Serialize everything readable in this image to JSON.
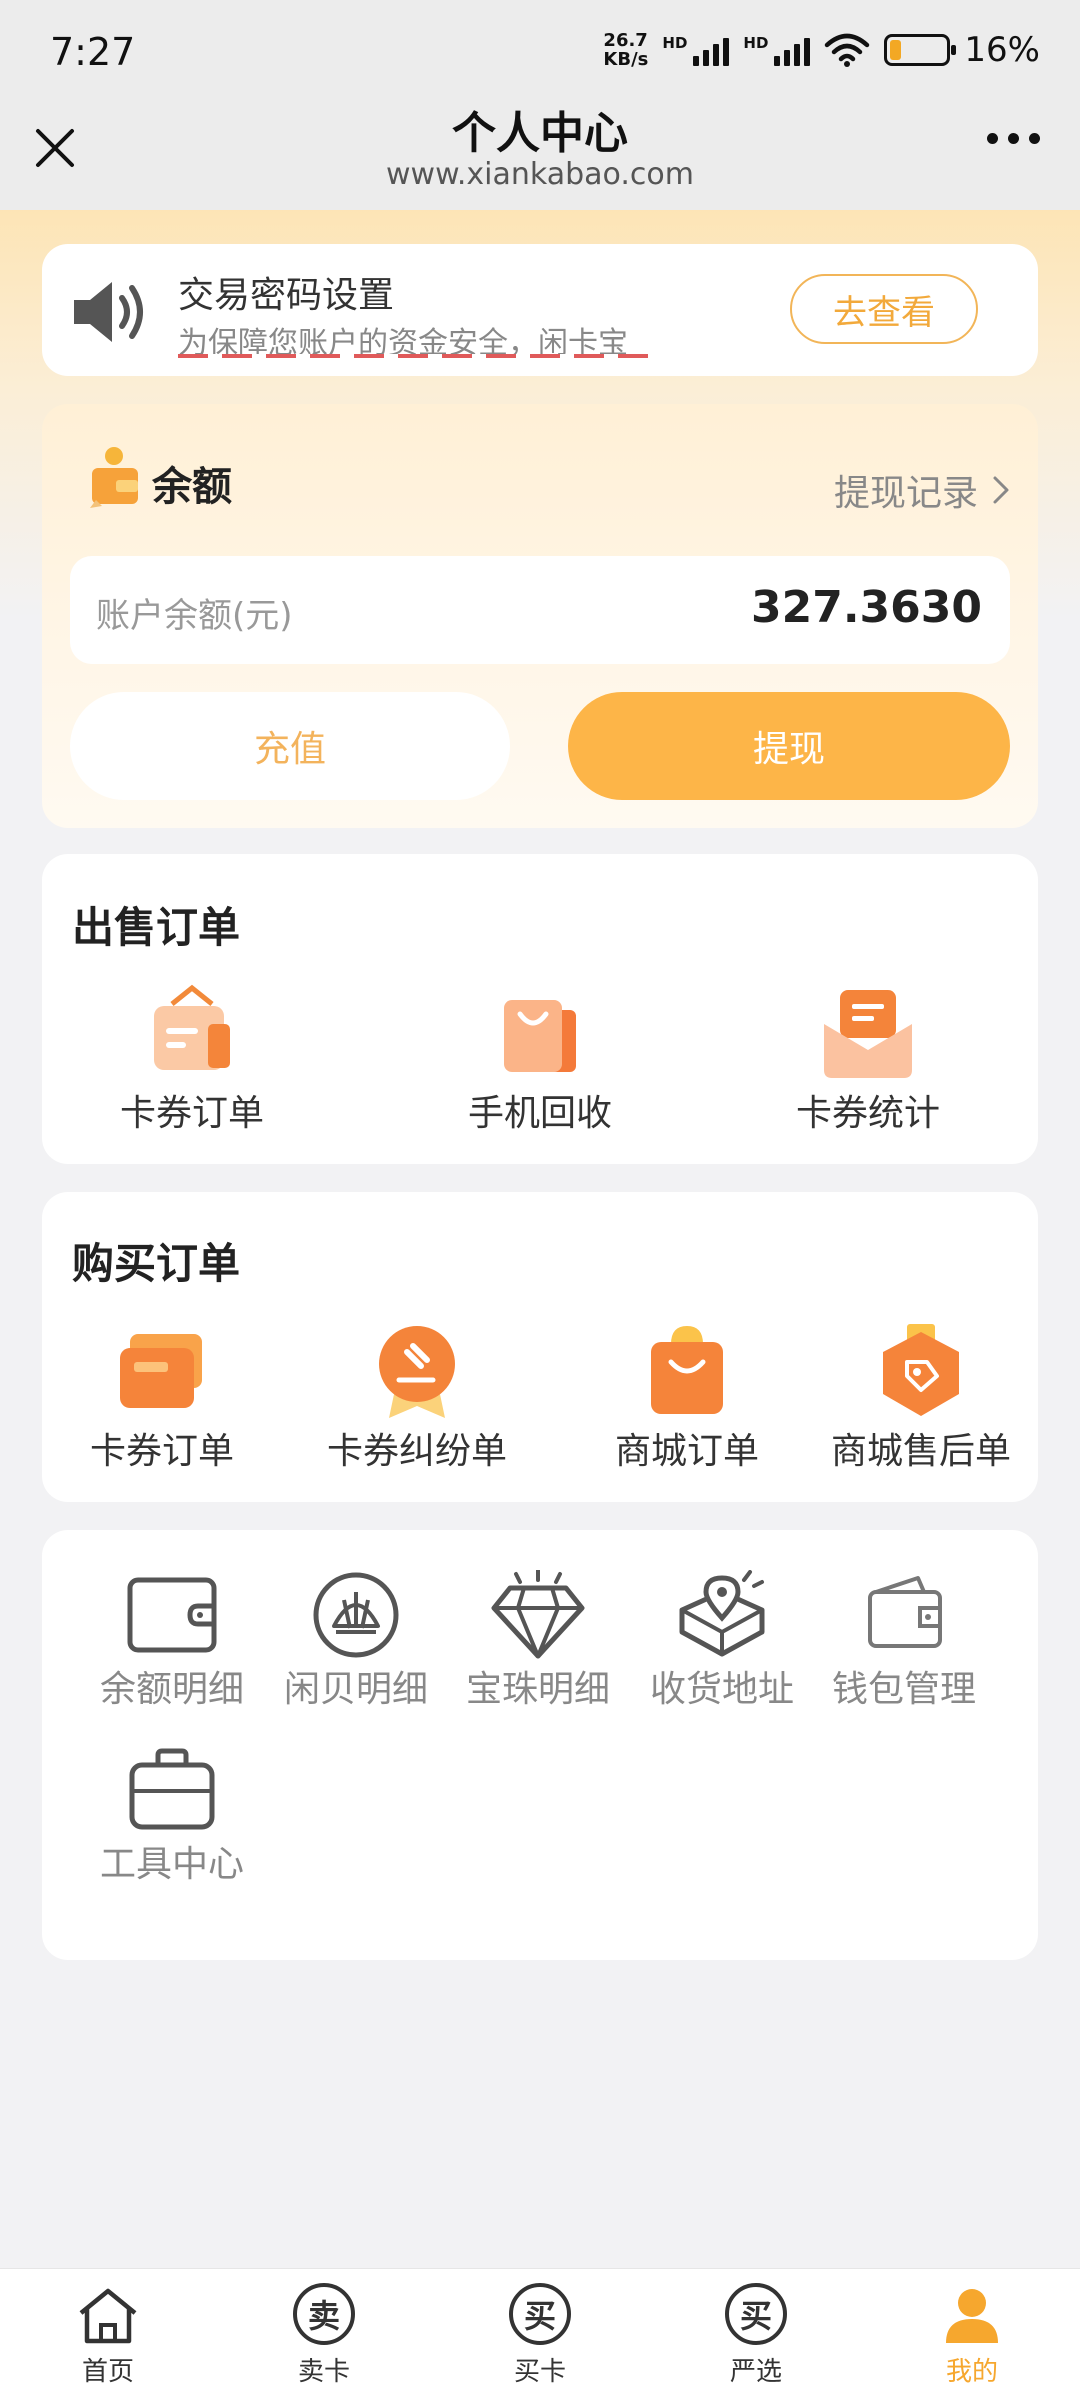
{
  "status_bar": {
    "time": "7:27",
    "net_speed_value": "26.7",
    "net_speed_unit": "KB/s",
    "hd1": "HD",
    "hd2": "HD",
    "battery": "16%"
  },
  "nav": {
    "title": "个人中心",
    "url": "www.xiankabao.com"
  },
  "notice": {
    "title": "交易密码设置",
    "desc": "为保障您账户的资金安全，闲卡宝",
    "button": "去查看"
  },
  "balance": {
    "title": "余额",
    "records_link": "提现记录",
    "account_label": "账户余额(元)",
    "amount": "327.3630",
    "recharge": "充值",
    "withdraw": "提现"
  },
  "sell_orders": {
    "title": "出售订单",
    "items": [
      {
        "label": "卡券订单"
      },
      {
        "label": "手机回收"
      },
      {
        "label": "卡券统计"
      }
    ]
  },
  "buy_orders": {
    "title": "购买订单",
    "items": [
      {
        "label": "卡券订单"
      },
      {
        "label": "卡券纠纷单"
      },
      {
        "label": "商城订单"
      },
      {
        "label": "商城售后单"
      }
    ]
  },
  "tools": {
    "items": [
      {
        "label": "余额明细"
      },
      {
        "label": "闲贝明细"
      },
      {
        "label": "宝珠明细"
      },
      {
        "label": "收货地址"
      },
      {
        "label": "钱包管理"
      },
      {
        "label": "工具中心"
      }
    ]
  },
  "tabbar": {
    "items": [
      {
        "label": "首页",
        "glyph": ""
      },
      {
        "label": "卖卡",
        "glyph": "卖"
      },
      {
        "label": "买卡",
        "glyph": "买"
      },
      {
        "label": "严选",
        "glyph": "买"
      },
      {
        "label": "我的",
        "glyph": ""
      }
    ],
    "active_color": "#f6a72e"
  },
  "colors": {
    "accent": "#fdb548",
    "accent_text": "#f2a93b"
  }
}
